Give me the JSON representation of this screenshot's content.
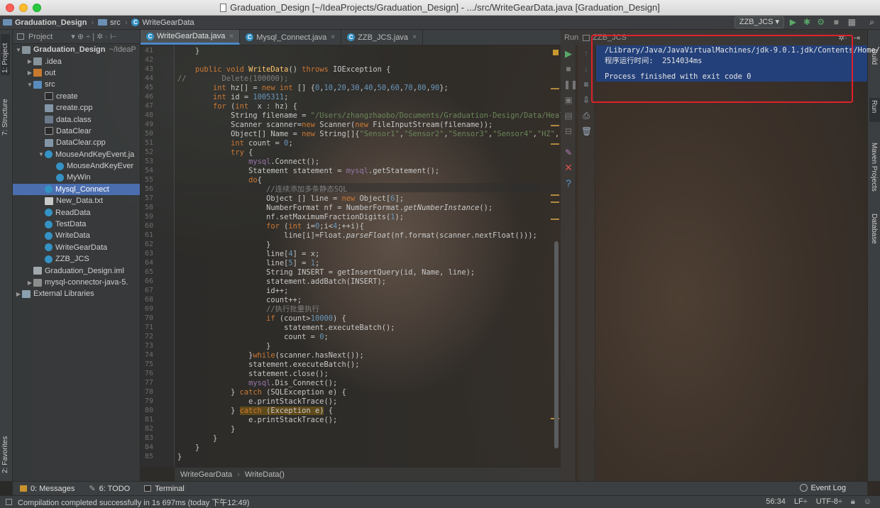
{
  "window": {
    "title": "Graduation_Design [~/IdeaProjects/Graduation_Design] - .../src/WriteGearData.java [Graduation_Design]"
  },
  "navbar": {
    "crumbs": [
      "Graduation_Design",
      "src",
      "WriteGearData"
    ],
    "run_config": "ZZB_JCS"
  },
  "left_tabs": [
    "1: Project",
    "7: Structure",
    "2: Favorites"
  ],
  "right_tabs": [
    "Ant Build",
    "4: Run",
    "Maven Projects",
    "Database"
  ],
  "project_panel": {
    "header": "Project",
    "tree": [
      {
        "label": "Graduation_Design",
        "suffix": "~/IdeaP",
        "type": "folder",
        "indent": 0,
        "arrow": "▼"
      },
      {
        "label": ".idea",
        "type": "folder",
        "indent": 1,
        "arrow": "▶"
      },
      {
        "label": "out",
        "type": "folder-out",
        "indent": 1,
        "arrow": "▶"
      },
      {
        "label": "src",
        "type": "folder-src",
        "indent": 1,
        "arrow": "▼"
      },
      {
        "label": "create",
        "type": "exe",
        "indent": 2
      },
      {
        "label": "create.cpp",
        "type": "cpp",
        "indent": 2
      },
      {
        "label": "data.class",
        "type": "cls",
        "indent": 2
      },
      {
        "label": "DataClear",
        "type": "exe",
        "indent": 2
      },
      {
        "label": "DataClear.cpp",
        "type": "cpp",
        "indent": 2
      },
      {
        "label": "MouseAndKeyEvent.ja",
        "type": "java",
        "indent": 2,
        "arrow": "▼"
      },
      {
        "label": "MouseAndKeyEver",
        "type": "java",
        "indent": 3
      },
      {
        "label": "MyWin",
        "type": "java",
        "indent": 3
      },
      {
        "label": "Mysql_Connect",
        "type": "java",
        "indent": 2,
        "selected": true
      },
      {
        "label": "New_Data.txt",
        "type": "txt",
        "indent": 2
      },
      {
        "label": "ReadData",
        "type": "java",
        "indent": 2
      },
      {
        "label": "TestData",
        "type": "java",
        "indent": 2
      },
      {
        "label": "WriteData",
        "type": "java",
        "indent": 2
      },
      {
        "label": "WriteGearData",
        "type": "java",
        "indent": 2
      },
      {
        "label": "ZZB_JCS",
        "type": "java",
        "indent": 2
      },
      {
        "label": "Graduation_Design.iml",
        "type": "iml",
        "indent": 1
      },
      {
        "label": "mysql-connector-java-5.",
        "type": "jar",
        "indent": 1,
        "arrow": "▶"
      },
      {
        "label": "External Libraries",
        "type": "lib",
        "indent": 0,
        "arrow": "▶"
      }
    ]
  },
  "editor_tabs": [
    {
      "label": "WriteGearData.java",
      "active": true
    },
    {
      "label": "Mysql_Connect.java",
      "active": false
    },
    {
      "label": "ZZB_JCS.java",
      "active": false
    }
  ],
  "code_lines": [
    {
      "n": "41",
      "html": "    }"
    },
    {
      "n": "42",
      "html": ""
    },
    {
      "n": "43",
      "html": "    <span class=\"kw\">public void</span> <span class=\"fn\">WriteData</span>() <span class=\"kw\">throws</span> IOException {"
    },
    {
      "n": "44",
      "html": "<span class=\"cm\">//        Delete(100000);</span>"
    },
    {
      "n": "45",
      "html": "        <span class=\"kw\">int</span> hz[] = <span class=\"kw\">new int</span> [] {<span class=\"num\">0</span>,<span class=\"num\">10</span>,<span class=\"num\">20</span>,<span class=\"num\">30</span>,<span class=\"num\">40</span>,<span class=\"num\">50</span>,<span class=\"num\">60</span>,<span class=\"num\">70</span>,<span class=\"num\">80</span>,<span class=\"num\">90</span>};"
    },
    {
      "n": "46",
      "html": "        <span class=\"kw\">int</span> id = <span class=\"num\">1005311</span>;"
    },
    {
      "n": "47",
      "html": "        <span class=\"kw\">for</span> (<span class=\"kw\">int</span>  x : hz) {"
    },
    {
      "n": "48",
      "html": "            String filename = <span class=\"str\">\"/Users/zhangzhaobo/Documents/Graduation-Design/Data/Healthy</span>"
    },
    {
      "n": "49",
      "html": "            Scanner scanner=<span class=\"kw\">new</span> Scanner(<span class=\"kw\">new</span> FileInputStream(filename));"
    },
    {
      "n": "50",
      "html": "            Object[] Name = <span class=\"kw\">new</span> String[]{<span class=\"str\">\"Sensor1\"</span>,<span class=\"str\">\"Sensor2\"</span>,<span class=\"str\">\"Sensor3\"</span>,<span class=\"str\">\"Sensor4\"</span>,<span class=\"str\">\"HZ\"</span>,<span class=\"str\">\"ca</span>"
    },
    {
      "n": "51",
      "html": "            <span class=\"kw\">int</span> count = <span class=\"num\">0</span>;"
    },
    {
      "n": "52",
      "html": "            <span class=\"kw\">try</span> {"
    },
    {
      "n": "53",
      "html": "                <span class=\"fld\">mysql</span>.Connect();"
    },
    {
      "n": "54",
      "html": "                Statement statement = <span class=\"fld\">mysql</span>.getStatement();"
    },
    {
      "n": "55",
      "html": "                <span class=\"kw\">do</span>{"
    },
    {
      "n": "56",
      "html": "                    <span class=\"cm\">//连续添加多条静态SQL</span>"
    },
    {
      "n": "57",
      "html": "                    Object [] line = <span class=\"kw\">new</span> Object[<span class=\"num\">6</span>];"
    },
    {
      "n": "58",
      "html": "                    NumberFormat nf = NumberFormat.<span class=\"it\">getNumberInstance</span>();"
    },
    {
      "n": "59",
      "html": "                    nf.setMaximumFractionDigits(<span class=\"num\">1</span>);"
    },
    {
      "n": "60",
      "html": "                    <span class=\"kw\">for</span> (<span class=\"kw\">int</span> i=<span class=\"num\">0</span>;i&lt;<span class=\"num\">4</span>;++i){"
    },
    {
      "n": "61",
      "html": "                        line[i]=Float.<span class=\"it\">parseFloat</span>(nf.format(scanner.nextFloat()));"
    },
    {
      "n": "62",
      "html": "                    }"
    },
    {
      "n": "63",
      "html": "                    line[<span class=\"num\">4</span>] = x;"
    },
    {
      "n": "64",
      "html": "                    line[<span class=\"num\">5</span>] = <span class=\"num\">1</span>;"
    },
    {
      "n": "65",
      "html": "                    String INSERT = getInsertQuery(id, Name, line);"
    },
    {
      "n": "66",
      "html": "                    statement.addBatch(INSERT);"
    },
    {
      "n": "67",
      "html": "                    id++;"
    },
    {
      "n": "68",
      "html": "                    count++;"
    },
    {
      "n": "69",
      "html": "                    <span class=\"cm\">//执行批量执行</span>"
    },
    {
      "n": "70",
      "html": "                    <span class=\"kw\">if</span> (count&gt;<span class=\"num\">10000</span>) {"
    },
    {
      "n": "71",
      "html": "                        statement.executeBatch();"
    },
    {
      "n": "72",
      "html": "                        count = <span class=\"num\">0</span>;"
    },
    {
      "n": "73",
      "html": "                    }"
    },
    {
      "n": "74",
      "html": "                }<span class=\"kw\">while</span>(scanner.hasNext());"
    },
    {
      "n": "75",
      "html": "                statement.executeBatch();"
    },
    {
      "n": "76",
      "html": "                statement.close();"
    },
    {
      "n": "77",
      "html": "                <span class=\"fld\">mysql</span>.Dis_Connect();"
    },
    {
      "n": "78",
      "html": "            } <span class=\"kw\">catch</span> (SQLException e) {"
    },
    {
      "n": "79",
      "html": "                e.printStackTrace();"
    },
    {
      "n": "80",
      "html": "            } <span class=\"kw hl-catch\">catch</span><span class=\"hl-catch\"> (Exception e)</span> {"
    },
    {
      "n": "81",
      "html": "                e.printStackTrace();"
    },
    {
      "n": "82",
      "html": "            }"
    },
    {
      "n": "83",
      "html": "        }"
    },
    {
      "n": "84",
      "html": "    }"
    },
    {
      "n": "85",
      "html": "}"
    }
  ],
  "editor_breadcrumb": [
    "WriteGearData",
    "WriteData()"
  ],
  "run_panel": {
    "label": "Run",
    "config": "ZZB_JCS",
    "output": [
      "/Library/Java/JavaVirtualMachines/jdk-9.0.1.jdk/Contents/Home/",
      "程序运行时间:  2514034ms",
      "",
      "Process finished with exit code 0"
    ]
  },
  "bottom_tabs": [
    "0: Messages",
    "6: TODO",
    "Terminal"
  ],
  "event_log": "Event Log",
  "status": {
    "message": "Compilation completed successfully in 1s 697ms (today 下午12:49)",
    "position": "56:34",
    "line_sep": "LF÷",
    "encoding": "UTF-8÷"
  },
  "accent_colors": {
    "keyword": "#cc7832",
    "string": "#6a8759",
    "number": "#6897bb",
    "selection": "#214283",
    "highlight_box": "#e0202a"
  }
}
